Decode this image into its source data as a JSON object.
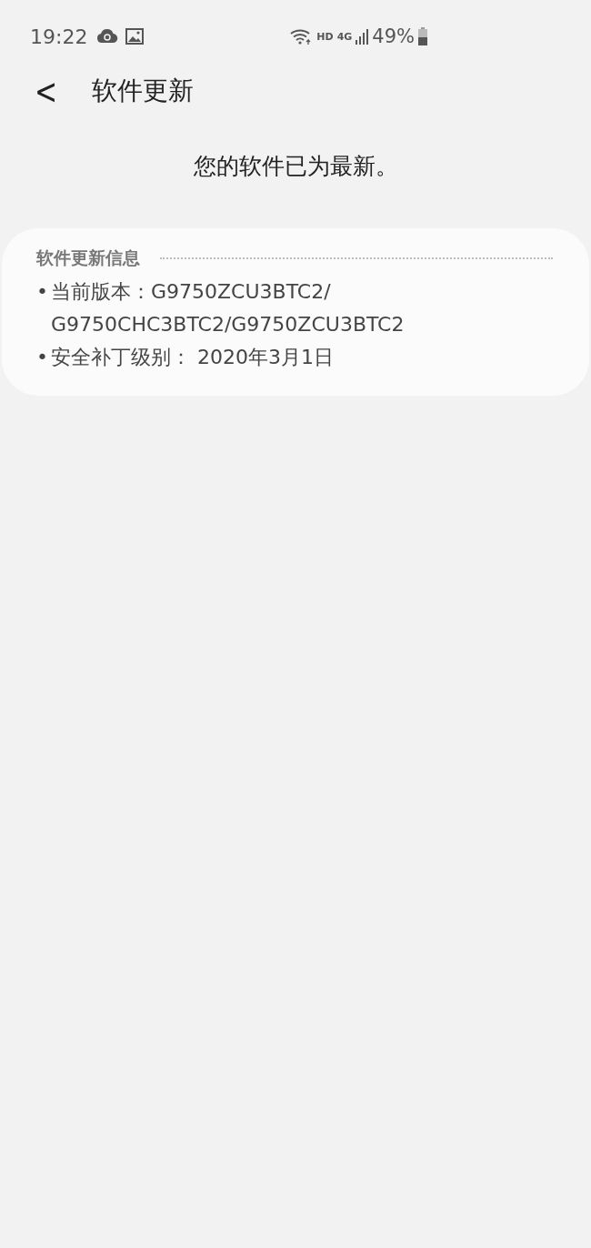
{
  "status_bar": {
    "time": "19:22",
    "hd": "HD",
    "network": "4G",
    "battery": "49%"
  },
  "header": {
    "back": "<",
    "title": "软件更新"
  },
  "message": "您的软件已为最新。",
  "info_card": {
    "title": "软件更新信息",
    "items": [
      {
        "bullet": "•",
        "lines": [
          "当前版本：G9750ZCU3BTC2/",
          "G9750CHC3BTC2/G9750ZCU3BTC2"
        ]
      },
      {
        "bullet": "•",
        "lines": [
          "安全补丁级别： 2020年3月1日"
        ]
      }
    ]
  }
}
